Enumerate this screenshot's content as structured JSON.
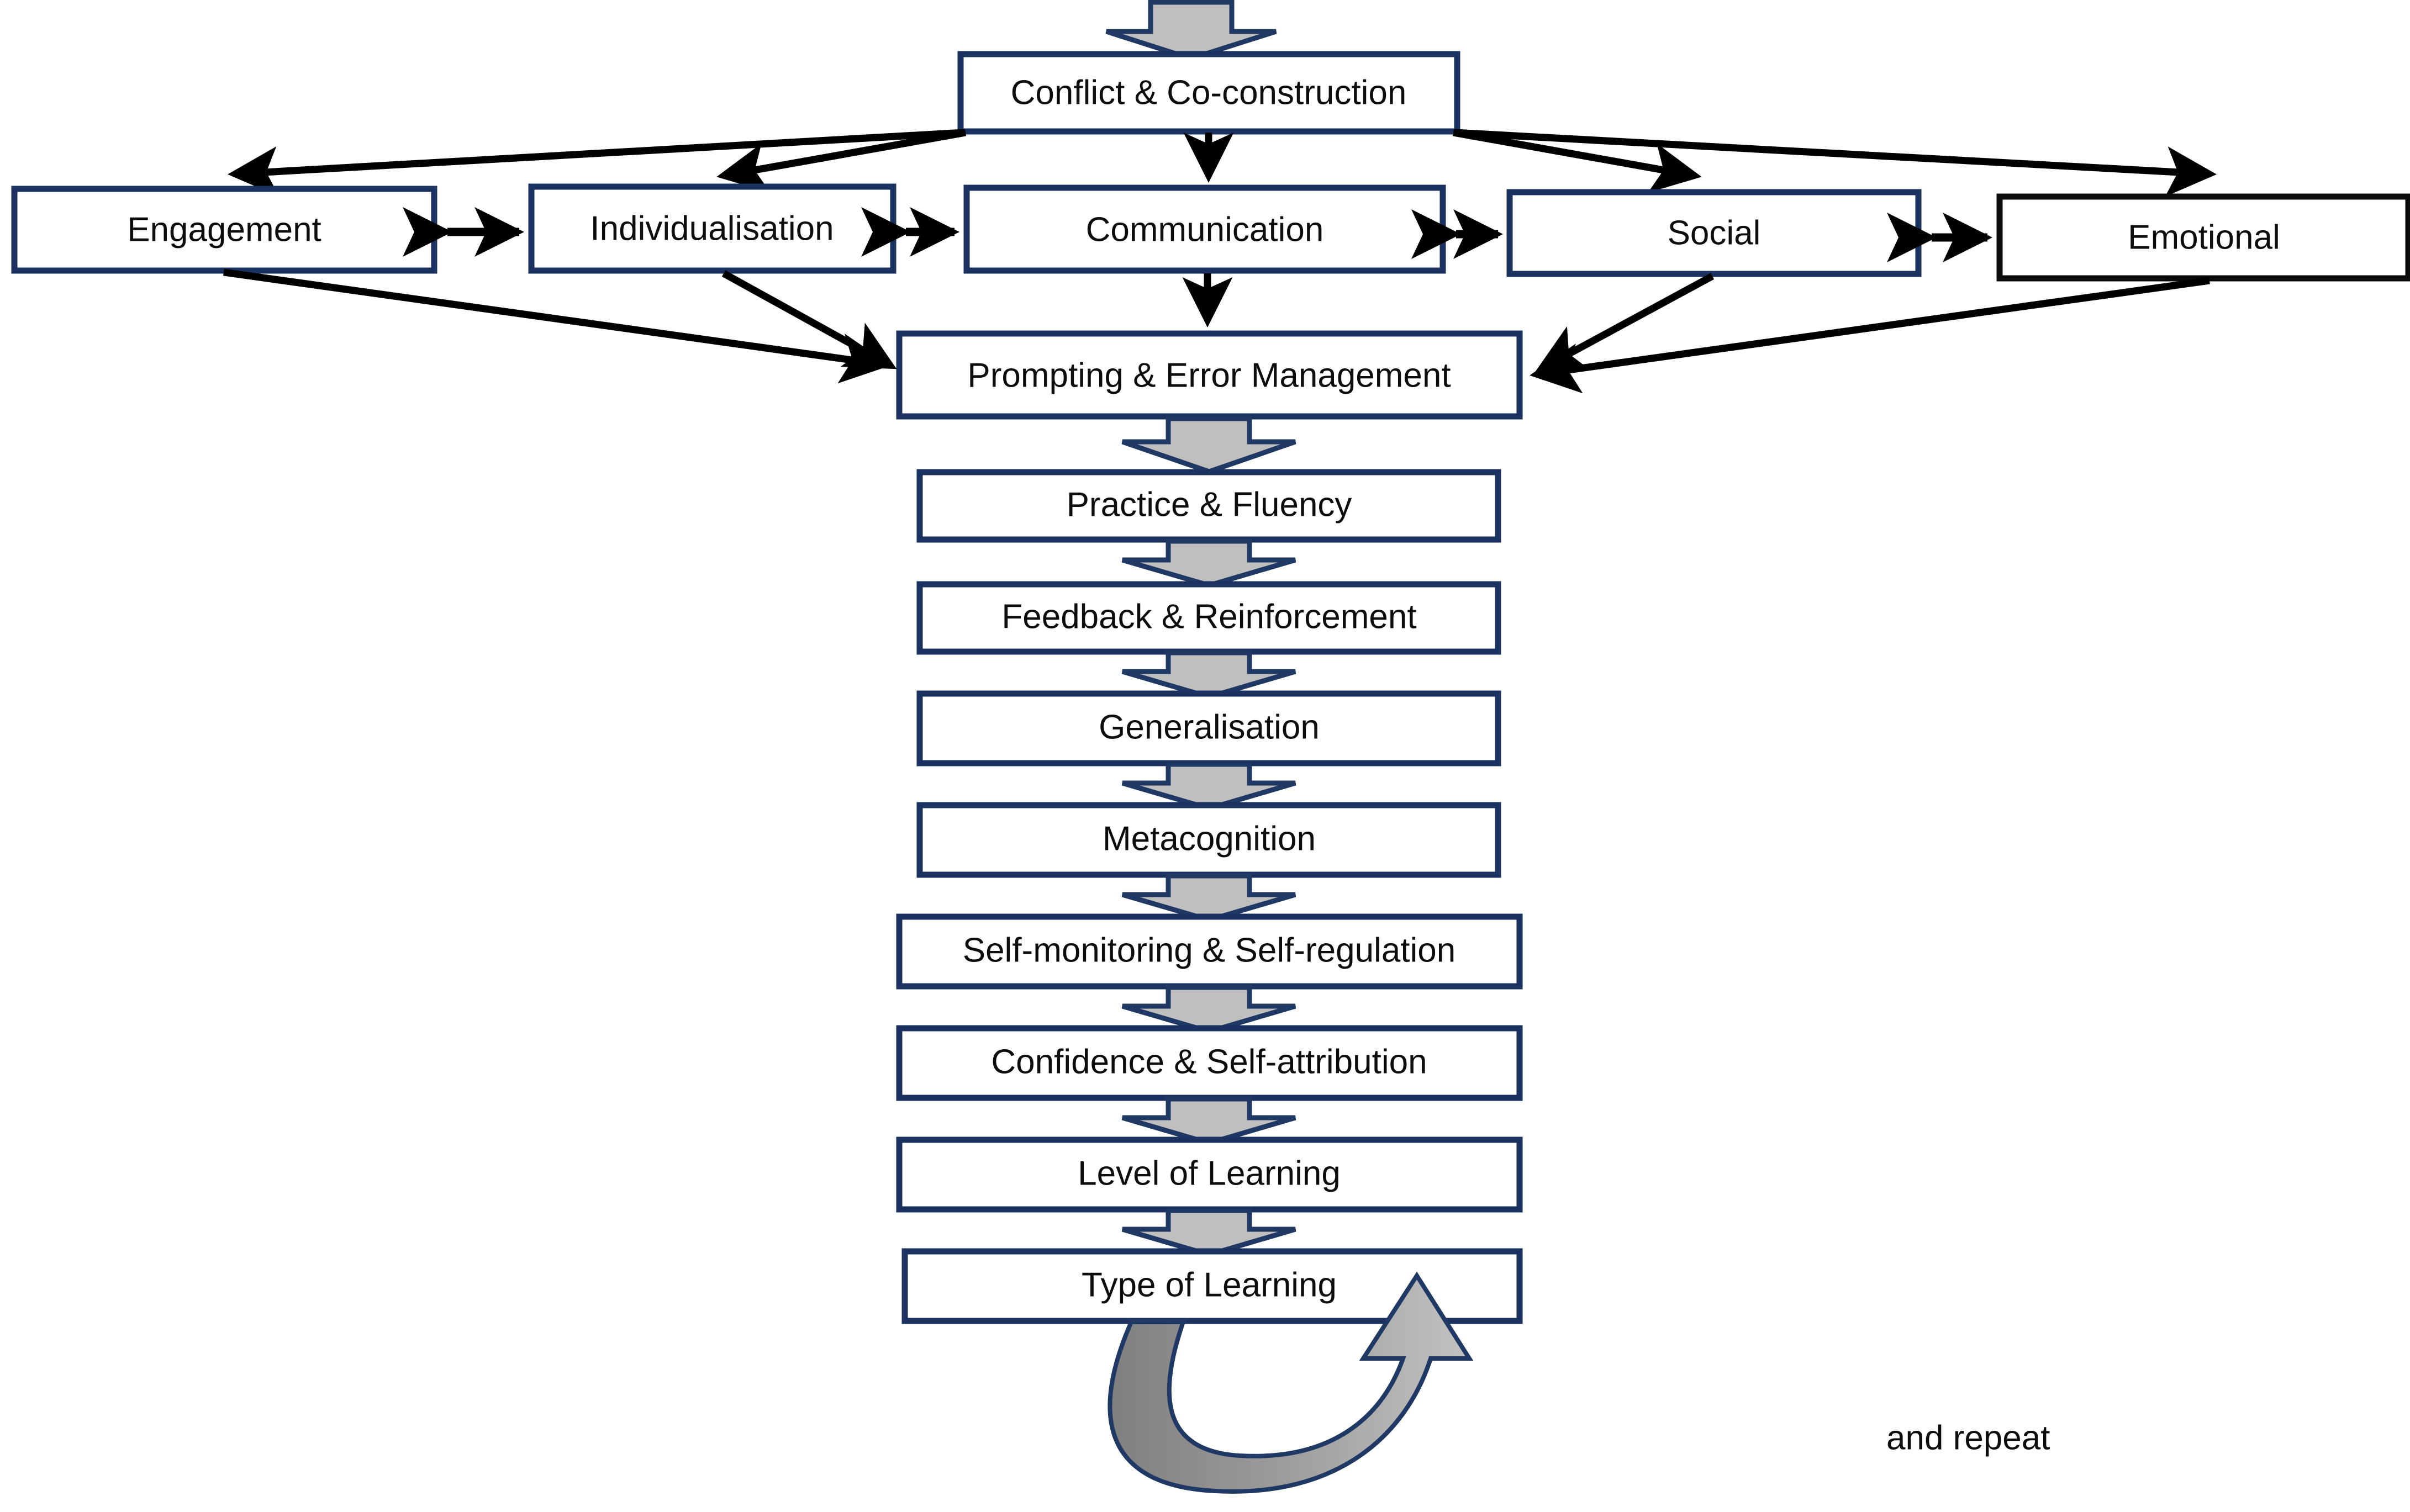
{
  "diagram": {
    "title_present": false,
    "top_box": {
      "label": "Conflict & Co-construction"
    },
    "factor_row": [
      {
        "label": "Engagement",
        "border_color": "#1b3160"
      },
      {
        "label": "Individualisation",
        "border_color": "#1b3160"
      },
      {
        "label": "Communication",
        "border_color": "#1b3160"
      },
      {
        "label": "Social",
        "border_color": "#1b3160"
      },
      {
        "label": "Emotional",
        "border_color": "#0b0b0b"
      }
    ],
    "chain": [
      {
        "label": "Prompting & Error Management"
      },
      {
        "label": "Practice & Fluency"
      },
      {
        "label": "Feedback & Reinforcement"
      },
      {
        "label": "Generalisation"
      },
      {
        "label": "Metacognition"
      },
      {
        "label": "Self-monitoring & Self-regulation"
      },
      {
        "label": "Confidence & Self-attribution"
      },
      {
        "label": "Level of Learning"
      },
      {
        "label": "Type of Learning"
      }
    ],
    "loop": {
      "label": "and repeat"
    },
    "colors": {
      "box_border_navy": "#1b3160",
      "box_border_black": "#0b0b0b",
      "arrow_fill_gray": "#bfbfbf",
      "arrow_outline_navy": "#1f3864",
      "connector_black": "#000000",
      "background": "#ffffff",
      "text": "#0d0d0d"
    }
  }
}
